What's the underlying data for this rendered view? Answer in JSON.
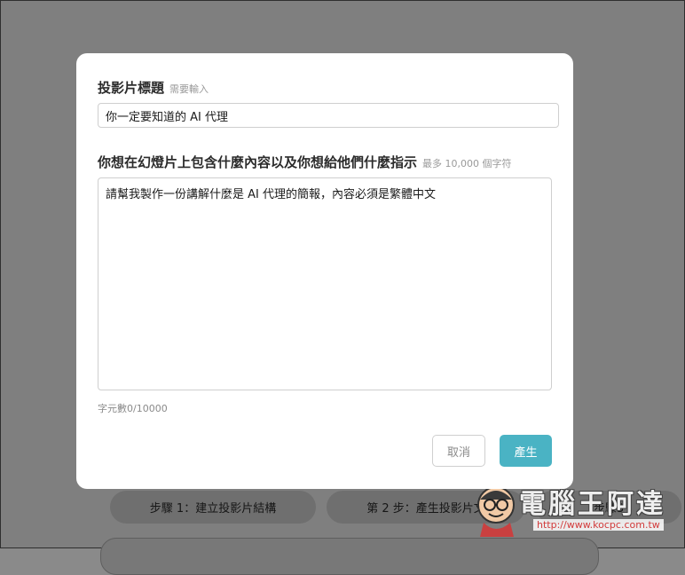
{
  "background": {
    "steps": [
      {
        "label": "步驟 1：建立投影片結構"
      },
      {
        "label": "第 2 步：產生投影片文"
      },
      {
        "label": "步驟3"
      }
    ]
  },
  "dialog": {
    "title_label": "投影片標題",
    "title_hint": "需要輸入",
    "title_value": "你一定要知道的 AI 代理",
    "instructions_label": "你想在幻燈片上包含什麼內容以及你想給他們什麼指示",
    "instructions_hint": "最多 10,000 個字符",
    "instructions_value": "請幫我製作一份講解什麼是 AI 代理的簡報，內容必須是繁體中文",
    "char_count": "字元數0/10000",
    "cancel_label": "取消",
    "generate_label": "產生"
  },
  "watermark": {
    "text": "電腦王阿達",
    "url": "http://www.kocpc.com.tw"
  },
  "colors": {
    "accent": "#4ab3c4",
    "overlay": "#7f7f7f",
    "watermark_url": "#d23b3b"
  }
}
